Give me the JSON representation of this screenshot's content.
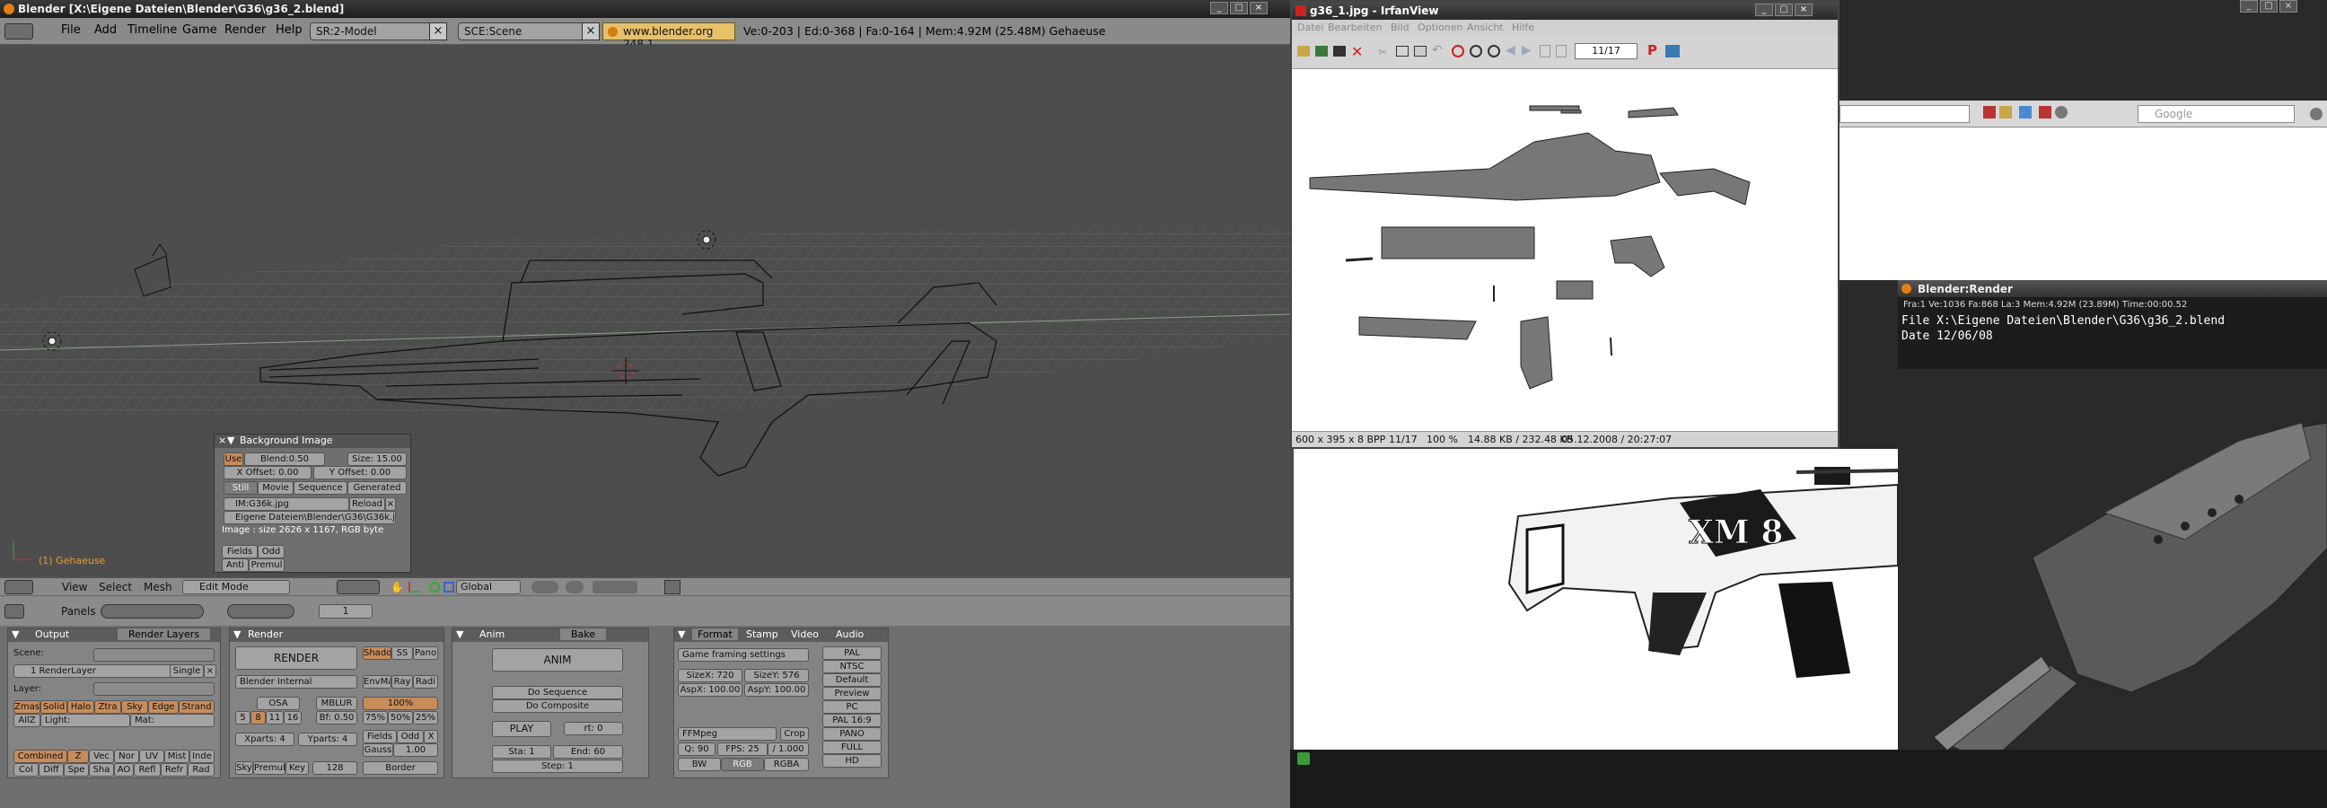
{
  "blender": {
    "title": "Blender [X:\\Eigene Dateien\\Blender\\G36\\g36_2.blend]",
    "menus": [
      "File",
      "Add",
      "Timeline",
      "Game",
      "Render",
      "Help"
    ],
    "screen_field": "SR:2-Model",
    "scene_field": "SCE:Scene",
    "url": "www.blender.org 248.1",
    "stats": "Ve:0-203 | Ed:0-368 | Fa:0-164 | Mem:4.92M (25.48M) Gehaeuse",
    "object_label": "(1) Gehaeuse",
    "viewport_header": {
      "items": [
        "View",
        "Select",
        "Mesh"
      ],
      "mode": "Edit Mode",
      "orientation": "Global"
    },
    "buttons_header": {
      "panels_label": "Panels",
      "frame": "1"
    },
    "background_image_panel": {
      "title": "Background Image",
      "use": "Use",
      "blend": "Blend:0.50",
      "size": "Size: 15.00",
      "x_offset": "X Offset: 0.00",
      "y_offset": "Y Offset: 0.00",
      "tabs": [
        "Still",
        "Movie",
        "Sequence",
        "Generated"
      ],
      "image_name": "IM:G36k.jpg",
      "reload": "Reload",
      "path": "Eigene Dateien\\Blender\\G36\\G36k.jpg",
      "info": "Image : size 2626 x 1167, RGB byte",
      "fields": "Fields",
      "odd": "Odd",
      "anti": "Anti",
      "premul": "Premul"
    },
    "output_panel": {
      "tabs": [
        "Output",
        "Render Layers"
      ],
      "scene": "Scene:",
      "render_layer": "1 RenderLayer",
      "single": "Single",
      "layer": "Layer:",
      "row1": [
        "Zmas",
        "Solid",
        "Halo",
        "Ztra",
        "Sky",
        "Edge",
        "Strand"
      ],
      "allz": "AllZ",
      "light": "Light:",
      "mat": "Mat:",
      "passes1": [
        "Combined",
        "Z",
        "Vec",
        "Nor",
        "UV",
        "Mist",
        "Inde"
      ],
      "passes2": [
        "Col",
        "Diff",
        "Spe",
        "Sha",
        "AO",
        "Refl",
        "Refr",
        "Rad"
      ]
    },
    "render_panel": {
      "tab": "Render",
      "render_btn": "RENDER",
      "shado": "Shado",
      "ss": "SS",
      "pano": "Pano",
      "engine": "Blender Internal",
      "envma": "EnvMa",
      "ray": "Ray",
      "radi": "Radi",
      "osa": "OSA",
      "mblur": "MBLUR",
      "pct100": "100%",
      "osa_vals": [
        "5",
        "8",
        "11",
        "16"
      ],
      "bf": "Bf: 0.50",
      "pct": [
        "75%",
        "50%",
        "25%"
      ],
      "xparts": "Xparts: 4",
      "yparts": "Yparts: 4",
      "fields": "Fields",
      "odd": "Odd",
      "x": "X",
      "gauss": "Gauss",
      "gauss_val": "1.00",
      "sky": "Sky",
      "premul": "Premul",
      "key": "Key",
      "val128": "128",
      "border": "Border"
    },
    "anim_panel": {
      "tabs": [
        "Anim",
        "Bake"
      ],
      "anim": "ANIM",
      "do_sequence": "Do Sequence",
      "do_composite": "Do Composite",
      "play": "PLAY",
      "rt": "rt: 0",
      "sta": "Sta: 1",
      "end": "End: 60",
      "step": "Step: 1"
    },
    "format_panel": {
      "tabs": [
        "Format",
        "Stamp",
        "Video",
        "Audio"
      ],
      "game_framing": "Game framing settings",
      "sizex": "SizeX: 720",
      "sizey": "SizeY: 576",
      "aspx": "AspX: 100.00",
      "aspy": "AspY: 100.00",
      "ffmpeg": "FFMpeg",
      "crop": "Crop",
      "q": "Q: 90",
      "fps": "FPS: 25",
      "fps2": "/ 1.000",
      "bw": "BW",
      "rgb": "RGB",
      "rgba": "RGBA",
      "presets": [
        "PAL",
        "NTSC",
        "Default",
        "Preview",
        "PC",
        "PAL 16:9",
        "PANO",
        "FULL",
        "HD"
      ]
    }
  },
  "irfanview": {
    "title": "g36_1.jpg - IrfanView",
    "menus": [
      "Datei",
      "Bearbeiten",
      "Bild",
      "Optionen",
      "Ansicht",
      "Hilfe"
    ],
    "page": "11/17",
    "status": [
      "600 x 395 x 8 BPP",
      "11/17",
      "100 %",
      "14.88 KB / 232.48 KB",
      "05.12.2008 / 20:27:07"
    ]
  },
  "browser": {
    "search_placeholder": "Google"
  },
  "render_window": {
    "title": "Blender:Render",
    "info": "Fra:1  Ve:1036 Fa:868 La:3 Mem:4.92M (23.89M) Time:00:00.52",
    "file": "File X:\\Eigene Dateien\\Blender\\G36\\g36_2.blend",
    "date": "Date 12/06/08"
  },
  "gun_decal": "XM 8",
  "colors": {
    "blender_bg": "#4d4d4d",
    "url_bg": "#e6c16a",
    "active_button": "#c78c5a",
    "object_label": "#e89a2d"
  }
}
